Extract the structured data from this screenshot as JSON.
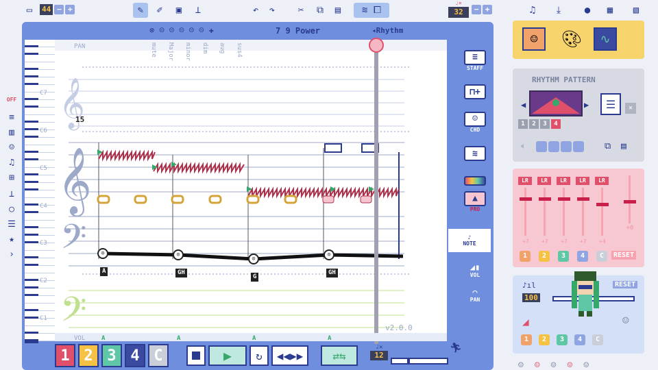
{
  "topbar": {
    "measure_count": "44",
    "tempo_marker_label": "♩×",
    "tempo_value": "32",
    "icons": [
      "folder-icon",
      "minus-icon",
      "plus-icon",
      "pencil-icon",
      "pen-icon",
      "window-icon",
      "stamp-icon",
      "undo-icon",
      "redo-icon",
      "cut-icon",
      "copy-icon",
      "paste-icon",
      "layers-icon",
      "duplicate-icon",
      "music-note-icon",
      "download-icon",
      "bomb-icon",
      "photo-icon",
      "gallery-icon"
    ]
  },
  "editor": {
    "chord_header_label": "7 9 Power",
    "rhythm_label": "Rhythm",
    "pan_label": "PAN",
    "vol_label": "VOL",
    "version": "v2.0.0",
    "chord_types": [
      "mute",
      "Major",
      "minor",
      "dim",
      "aug",
      "sus4"
    ],
    "octave_labels": [
      "C7",
      "C6",
      "C5",
      "C4",
      "C3",
      "C2",
      "C1"
    ],
    "treble_octave_marker": "15",
    "chords": [
      "A",
      "GH",
      "G",
      "GH"
    ],
    "vol_markers": [
      "A",
      "A",
      "A",
      "A"
    ]
  },
  "tools": {
    "staff": "STAFF",
    "chord": "CHD",
    "pro": "PRO",
    "note": "NOTE",
    "vol": "VOL",
    "pan": "PAN"
  },
  "bottom": {
    "tracks": [
      "1",
      "2",
      "3",
      "4",
      "C"
    ],
    "track_colors": [
      "#e0506a",
      "#f6c246",
      "#5fc7a6",
      "#3a4aa0",
      "#c9ced8"
    ],
    "step_label": "12"
  },
  "rhythm_panel": {
    "title": "RHYTHM PATTERN",
    "steps": [
      "1",
      "2",
      "3",
      "4"
    ]
  },
  "mixer": {
    "lr_labels": [
      "LR",
      "LR",
      "LR",
      "LR",
      "LR"
    ],
    "values": [
      "+7",
      "+7",
      "+7",
      "+7",
      "+4"
    ],
    "master_value": "+0",
    "channel_nums": [
      "1",
      "2",
      "3",
      "4",
      "C"
    ],
    "channel_colors": [
      "#f0a26a",
      "#f6c246",
      "#5fc7a6",
      "#8fa4e0",
      "#c9ced8"
    ],
    "reset_label": "RESET"
  },
  "character_panel": {
    "reset_label": "RESET",
    "volume_value": "100",
    "channel_nums": [
      "1",
      "2",
      "3",
      "4",
      "C"
    ]
  },
  "left_sidebar": {
    "off_label": "OFF"
  }
}
